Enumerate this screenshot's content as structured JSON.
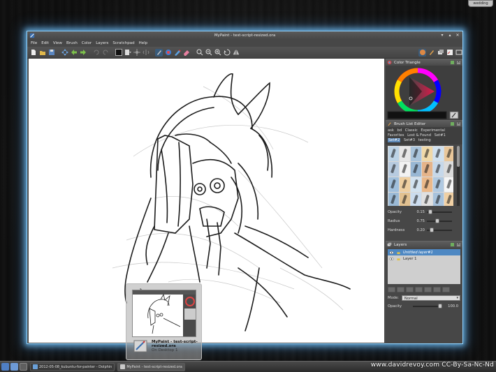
{
  "tray": {
    "label": "wedding"
  },
  "window": {
    "title": "MyPaint - test-script-resized.ora",
    "controls": [
      "▾",
      "▴",
      "✕"
    ]
  },
  "menu": [
    "File",
    "Edit",
    "View",
    "Brush",
    "Color",
    "Layers",
    "Scratchpad",
    "Help"
  ],
  "panels": {
    "color": {
      "title": "Color Triangle"
    },
    "brush": {
      "title": "Brush List Editor",
      "groups": [
        {
          "label": "ask",
          "selected": false
        },
        {
          "label": "bd",
          "selected": false
        },
        {
          "label": "Classic",
          "selected": false
        },
        {
          "label": "Experimental",
          "selected": false
        },
        {
          "label": "Favorites",
          "selected": false
        },
        {
          "label": "Lost & Found",
          "selected": false
        },
        {
          "label": "Set#1",
          "selected": false
        },
        {
          "label": "Set#2",
          "selected": true
        },
        {
          "label": "Set#3",
          "selected": false
        },
        {
          "label": "testing",
          "selected": false
        }
      ],
      "settings": [
        {
          "label": "Opacity",
          "value": "0.15",
          "fraction": 0.15
        },
        {
          "label": "Radius",
          "value": "0.75",
          "fraction": 0.42
        },
        {
          "label": "Hardness",
          "value": "0.20",
          "fraction": 0.2
        }
      ]
    },
    "layers": {
      "title": "Layers",
      "items": [
        {
          "name": "Untitled layer#1",
          "selected": true
        },
        {
          "name": "Layer 1",
          "selected": false
        }
      ],
      "mode_label": "Mode:",
      "mode_value": "Normal",
      "opacity_label": "Opacity",
      "opacity_value": "100.0"
    }
  },
  "taskbar": {
    "items": [
      {
        "label": "2012-05-08_kubuntu-for-painter - Dolphin",
        "color": "#6aa0d8"
      },
      {
        "label": "MyPaint - test-script-resized.ora",
        "color": "#c9c9c9"
      }
    ]
  },
  "preview": {
    "title": "MyPaint - test-script-resized.ora",
    "subtitle": "On Desktop 1"
  },
  "watermark": "www.davidrevoy.com CC-By-Sa-Nc-Nd",
  "colors": {
    "glow": "#8fd3ff",
    "selection": "#4e88c3",
    "brush_group_selected": "#5a87b7",
    "current_color": "#111111"
  }
}
